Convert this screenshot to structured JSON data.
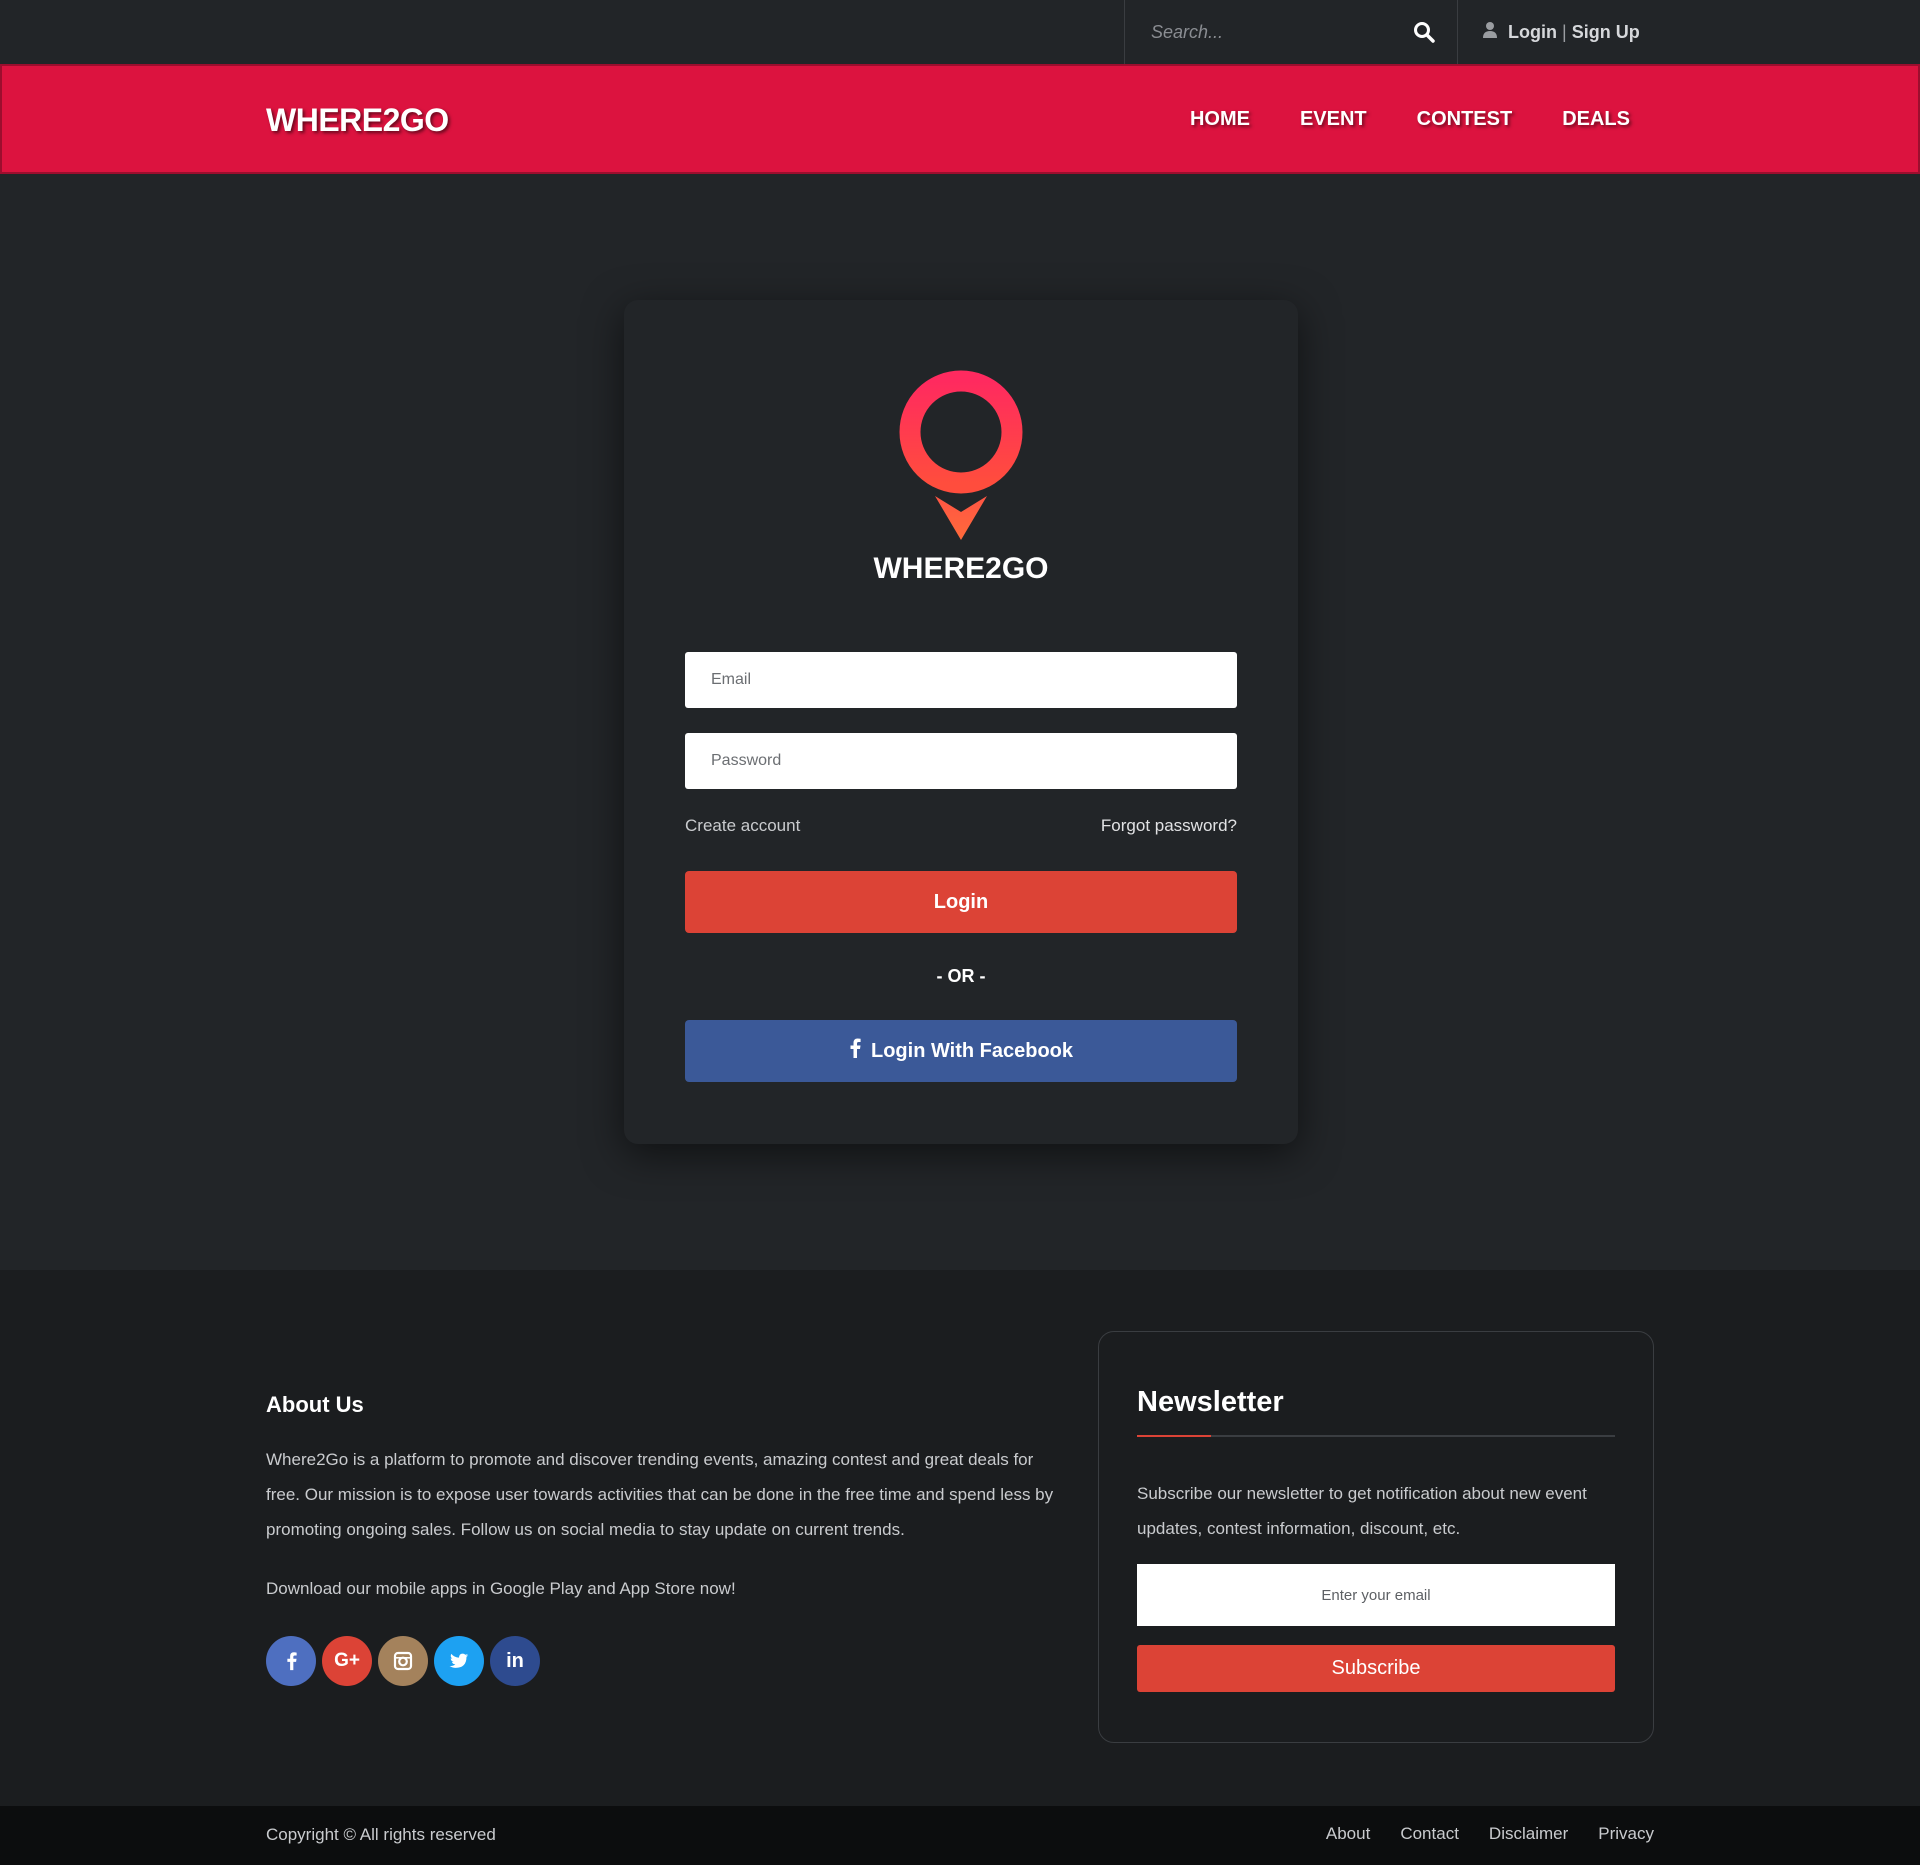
{
  "topbar": {
    "search_placeholder": "Search...",
    "search_icon": "search-icon",
    "user_icon": "user-icon",
    "login_label": "Login",
    "separator": "|",
    "signup_label": "Sign Up"
  },
  "navbar": {
    "brand": "WHERE2GO",
    "items": [
      {
        "label": "HOME"
      },
      {
        "label": "EVENT"
      },
      {
        "label": "CONTEST"
      },
      {
        "label": "DEALS"
      }
    ]
  },
  "login_card": {
    "logo_icon": "map-pin-icon",
    "logo_text": "WHERE2GO",
    "email_placeholder": "Email",
    "password_placeholder": "Password",
    "create_account": "Create account",
    "forgot_password": "Forgot password?",
    "login_button": "Login",
    "or_text": "- OR -",
    "facebook_button": "Login With Facebook"
  },
  "footer": {
    "about_title": "About Us",
    "about_text": "Where2Go is a platform to promote and discover trending events, amazing contest and great deals for free. Our mission is to expose user towards activities that can be done in the free time and spend less by promoting ongoing sales. Follow us on social media to stay update on current trends.",
    "download_text": "Download our mobile apps in Google Play and App Store now!",
    "socials": [
      {
        "name": "facebook-icon",
        "glyph": "f",
        "color": "#4e6fc0"
      },
      {
        "name": "google-plus-icon",
        "glyph": "G+",
        "color": "#dc4336"
      },
      {
        "name": "instagram-icon",
        "glyph": "◙",
        "color": "#a4825c"
      },
      {
        "name": "twitter-icon",
        "glyph": "🐦",
        "color": "#1da1f2"
      },
      {
        "name": "linkedin-icon",
        "glyph": "in",
        "color": "#2e4b8f"
      }
    ],
    "newsletter": {
      "title": "Newsletter",
      "text": "Subscribe our newsletter to get notification about new event updates, contest information, discount, etc.",
      "email_placeholder": "Enter your email",
      "subscribe_button": "Subscribe"
    },
    "copyright": "Copyright © All rights reserved",
    "links": [
      {
        "label": "About"
      },
      {
        "label": "Contact"
      },
      {
        "label": "Disclaimer"
      },
      {
        "label": "Privacy"
      }
    ]
  },
  "colors": {
    "brand_red": "#dc133f",
    "button_red": "#dc4336",
    "facebook_blue": "#3b5998",
    "background": "#222528"
  }
}
